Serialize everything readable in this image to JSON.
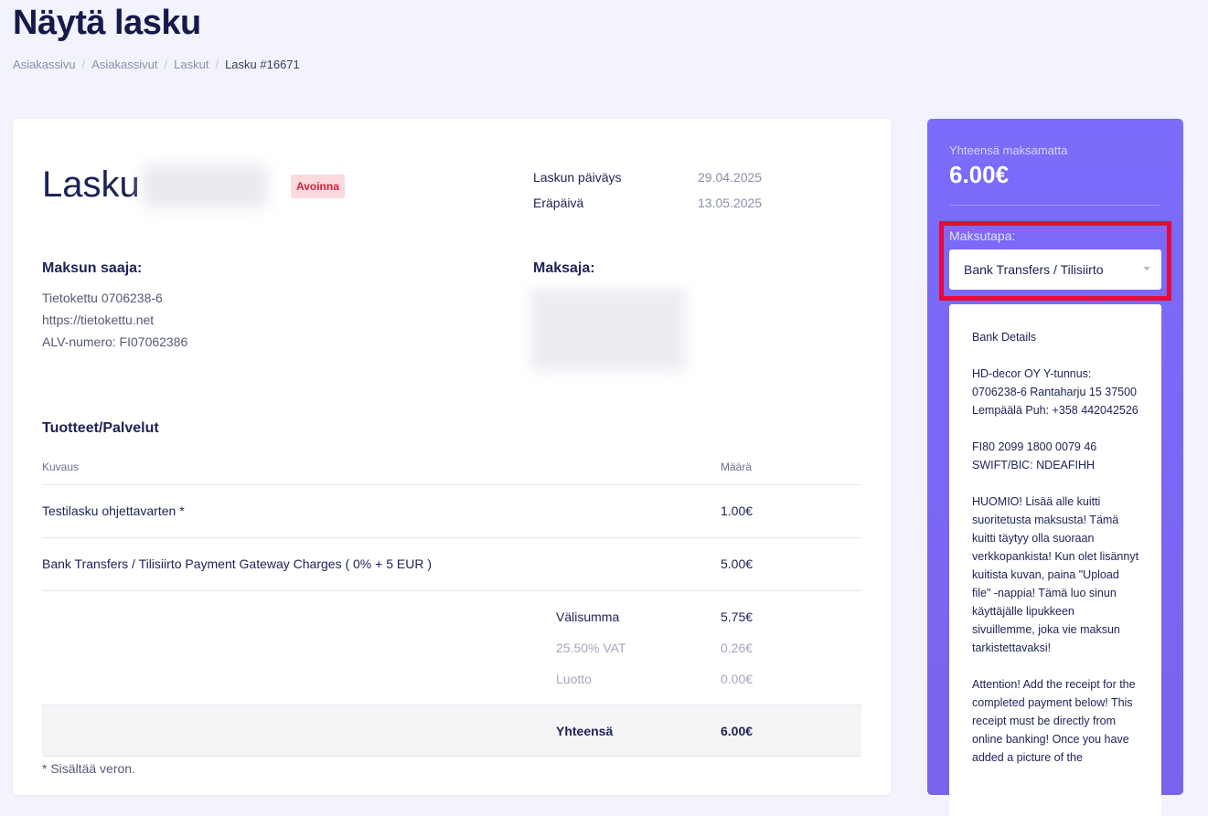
{
  "header": {
    "title": "Näytä lasku",
    "breadcrumb": [
      "Asiakassivu",
      "Asiakassivut",
      "Laskut",
      "Lasku #16671"
    ]
  },
  "invoice": {
    "heading": "Lasku",
    "status": "Avoinna",
    "date_label": "Laskun päiväys",
    "date_value": "29.04.2025",
    "due_label": "Eräpäivä",
    "due_value": "13.05.2025",
    "payee_title": "Maksun saaja:",
    "payee_lines": [
      "Tietokettu 0706238-6",
      "https://tietokettu.net",
      "ALV-numero: FI07062386"
    ],
    "payer_title": "Maksaja:"
  },
  "items": {
    "title": "Tuotteet/Palvelut",
    "col_desc": "Kuvaus",
    "col_amount": "Määrä",
    "rows": [
      {
        "desc": "Testilasku ohjettavarten *",
        "amount": "1.00€"
      },
      {
        "desc": "Bank Transfers / Tilisiirto Payment Gateway Charges ( 0% + 5 EUR )",
        "amount": "5.00€"
      }
    ],
    "subtotal_label": "Välisumma",
    "subtotal": "5.75€",
    "vat_label": "25.50% VAT",
    "vat": "0.26€",
    "credit_label": "Luotto",
    "credit": "0.00€",
    "total_label": "Yhteensä",
    "total": "6.00€",
    "footnote": "* Sisältää veron."
  },
  "side": {
    "unpaid_label": "Yhteensä maksamatta",
    "unpaid_total": "6.00€",
    "method_label": "Maksutapa:",
    "method_selected": "Bank Transfers / Tilisiirto",
    "details": [
      "Bank Details",
      "HD-decor OY Y-tunnus: 0706238-6 Rantaharju 15 37500 Lempäälä Puh: +358 442042526",
      "FI80 2099 1800 0079 46 SWIFT/BIC: NDEAFIHH",
      "HUOMIO! Lisää alle kuitti suoritetusta maksusta! Tämä kuitti täytyy olla suoraan verkkopankista! Kun olet lisännyt kuitista kuvan, paina \"Upload file\" -nappia! Tämä luo sinun käyttäjälle lipukkeen sivuillemme, joka vie maksun tarkistettavaksi!",
      "Attention! Add the receipt for the completed payment below! This receipt must be directly from online banking! Once you have added a picture of the"
    ]
  },
  "colors": {
    "accent": "#7b6cfb",
    "highlight": "#e8093a",
    "status_bg": "#fcd9dc",
    "status_fg": "#d21f3c"
  }
}
